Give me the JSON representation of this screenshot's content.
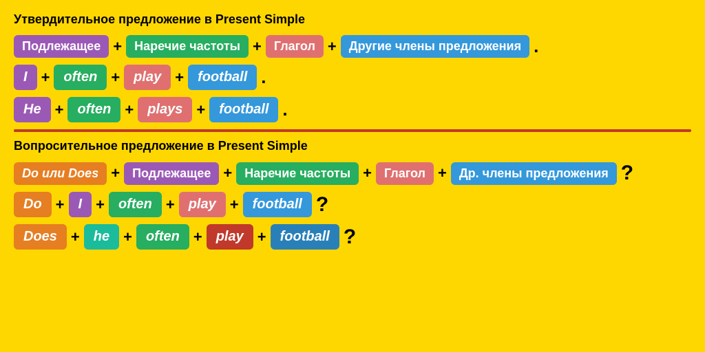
{
  "section1": {
    "title": "Утвердительное предложение в Present Simple",
    "formula_row": {
      "subject": "Подлежащее",
      "adverb": "Наречие частоты",
      "verb": "Глагол",
      "other": "Другие члены предложения"
    },
    "example1": {
      "subject": "I",
      "adverb": "often",
      "verb": "play",
      "other": "football"
    },
    "example2": {
      "subject": "He",
      "adverb": "often",
      "verb": "plays",
      "other": "football"
    }
  },
  "section2": {
    "title": "Вопросительное предложение в Present Simple",
    "formula_row": {
      "do_does": "Do или Does",
      "subject": "Подлежащее",
      "adverb": "Наречие частоты",
      "verb": "Глагол",
      "other": "Др. члены предложения"
    },
    "example1": {
      "do": "Do",
      "subject": "I",
      "adverb": "often",
      "verb": "play",
      "other": "football"
    },
    "example2": {
      "does": "Does",
      "subject": "he",
      "adverb": "often",
      "verb": "play",
      "other": "football"
    }
  },
  "symbols": {
    "plus": "+",
    "dot": ".",
    "question": "?"
  }
}
